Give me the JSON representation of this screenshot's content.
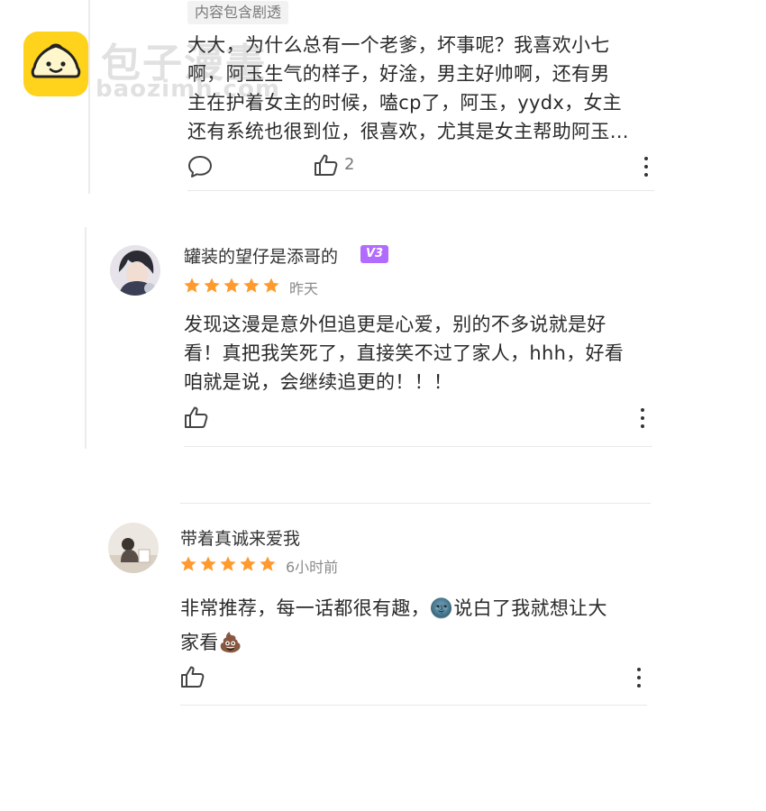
{
  "watermark": {
    "name_cn": "包子漫畫",
    "name_en": "baozimh.com"
  },
  "comments": [
    {
      "tag": "内容包含剧透",
      "lines": [
        "大大，为什么总有一个老爹，坏事呢？我喜欢小七",
        "啊，阿玉生气的样子，好淦，男主好帅啊，还有男",
        "主在护着女主的时候，嗑cp了，阿玉，yydx，女主",
        "还有系统也很到位，很喜欢，尤其是女主帮助阿玉…"
      ],
      "like_count": "2",
      "icons": [
        "comment-icon",
        "thumbs-up-icon",
        "more-icon"
      ]
    },
    {
      "username": "罐装的望仔是添哥的",
      "badge": "V3",
      "rating": 5,
      "time": "昨天",
      "lines": [
        "发现这漫是意外但追更是心爱，别的不多说就是好",
        "看！真把我笑死了，直接笑不过了家人，hhh，好看",
        "咱就是说，会继续追更的！！！"
      ],
      "icons": [
        "thumbs-up-icon",
        "more-icon"
      ]
    },
    {
      "username": "带着真诚来爱我",
      "rating": 5,
      "time": "6小时前",
      "lines": [
        "非常推荐，每一话都很有趣，🌚说白了我就想让大",
        "家看💩"
      ],
      "icons": [
        "thumbs-up-icon",
        "more-icon"
      ]
    }
  ],
  "colors": {
    "star": "#ff9a2e",
    "badge": "#b26bff",
    "watermark_logo": "#ffd21c"
  }
}
